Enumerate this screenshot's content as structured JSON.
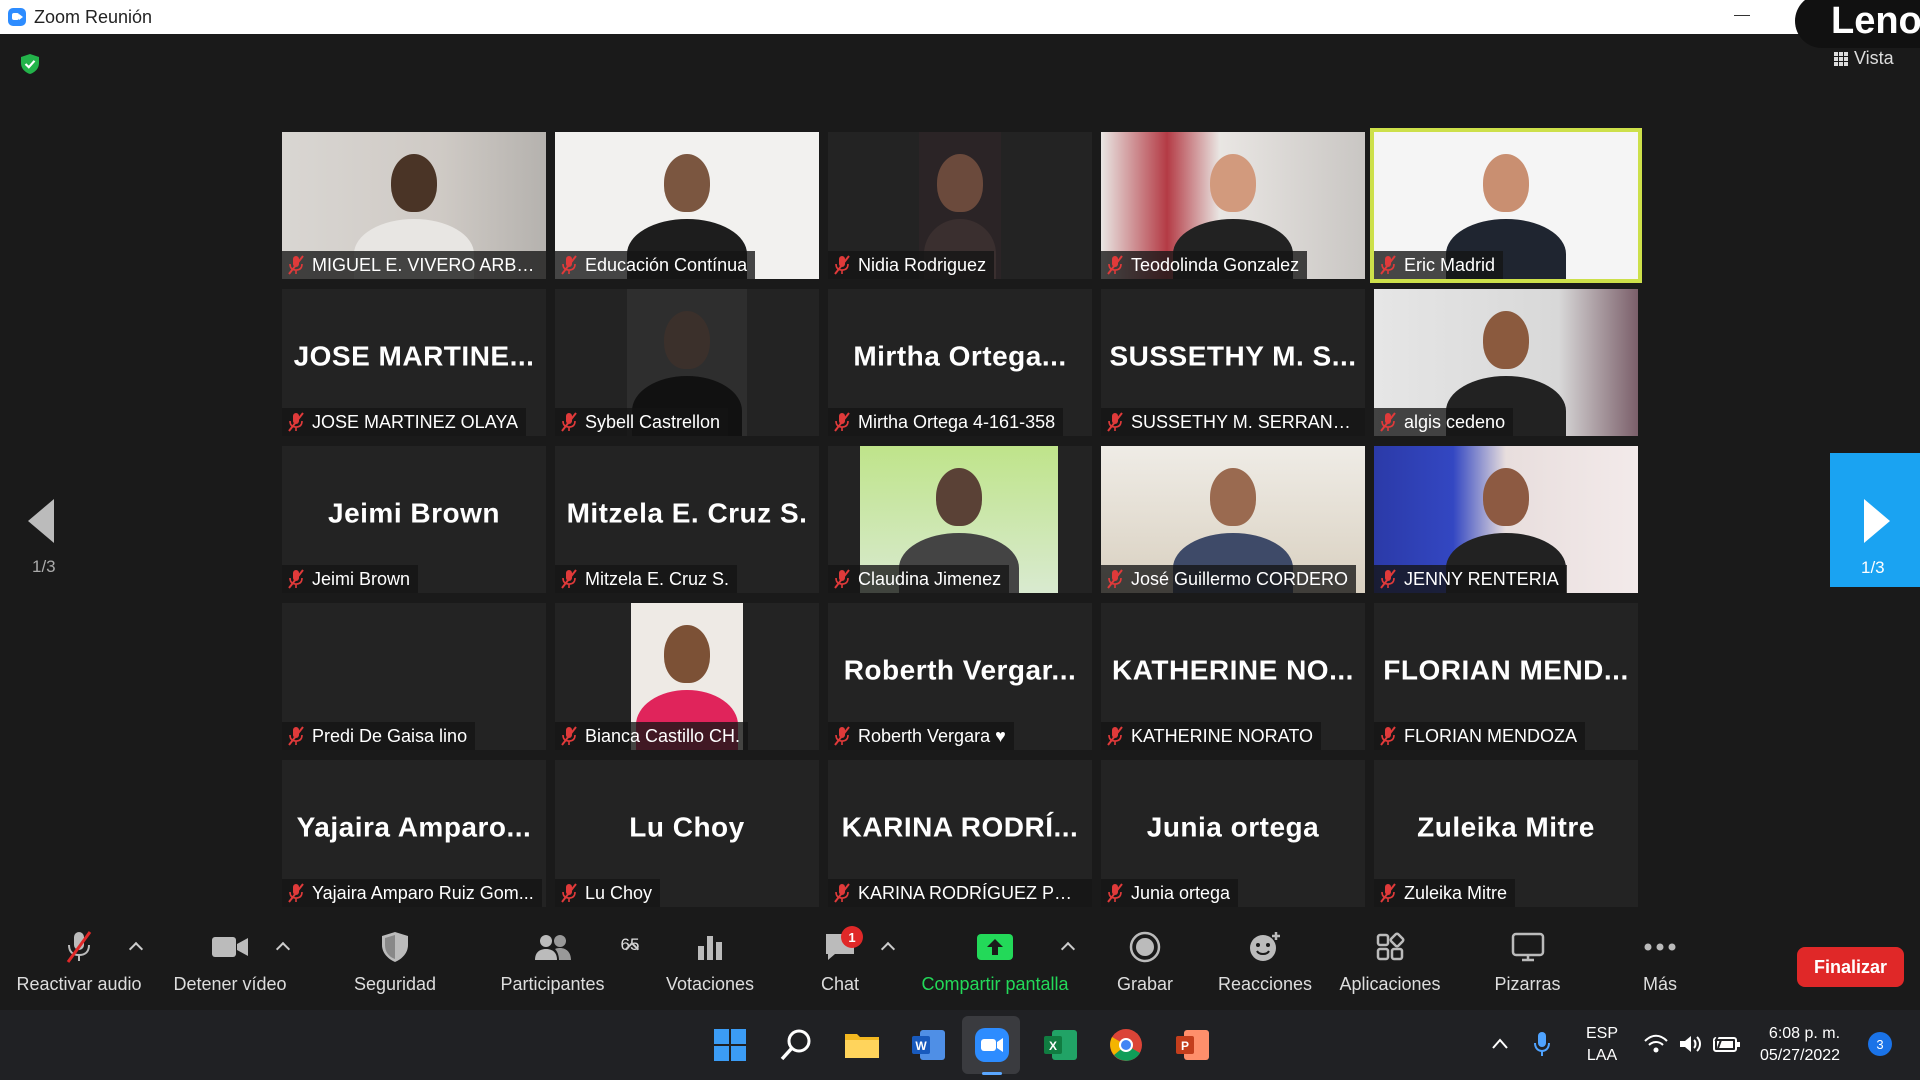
{
  "window": {
    "title": "Zoom Reunión",
    "brand": "Lenovo"
  },
  "header": {
    "view_label": "Vista"
  },
  "participants": [
    {
      "display": "",
      "label": "MIGUEL E. VIVERO ARBO...",
      "video": true
    },
    {
      "display": "",
      "label": "Educación Contínua",
      "video": true
    },
    {
      "display": "",
      "label": "Nidia Rodriguez",
      "video": true
    },
    {
      "display": "",
      "label": "Teodolinda Gonzalez",
      "video": true
    },
    {
      "display": "",
      "label": "Eric Madrid",
      "video": true,
      "active": true
    },
    {
      "display": "JOSE  MARTINE...",
      "label": "JOSE MARTINEZ OLAYA",
      "video": false
    },
    {
      "display": "",
      "label": "Sybell Castrellon",
      "video": true
    },
    {
      "display": "Mirtha  Ortega...",
      "label": "Mirtha Ortega 4-161-358",
      "video": false
    },
    {
      "display": "SUSSETHY  M.  S...",
      "label": "SUSSETHY M. SERRANO J.",
      "video": false
    },
    {
      "display": "",
      "label": "algis cedeno",
      "video": true
    },
    {
      "display": "Jeimi Brown",
      "label": "Jeimi Brown",
      "video": false
    },
    {
      "display": "Mitzela E. Cruz S.",
      "label": "Mitzela E. Cruz S.",
      "video": false
    },
    {
      "display": "",
      "label": "Claudina Jimenez",
      "video": true
    },
    {
      "display": "",
      "label": "José Guillermo CORDERO",
      "video": true
    },
    {
      "display": "",
      "label": "JENNY RENTERIA",
      "video": true
    },
    {
      "display": "",
      "label": "Predi De Gaisa lino",
      "video": false
    },
    {
      "display": "",
      "label": "Bianca Castillo CH.",
      "video": true
    },
    {
      "display": "Roberth  Vergar...",
      "label": "Roberth Vergara ♥",
      "video": false
    },
    {
      "display": "KATHERINE  NO...",
      "label": "KATHERINE NORATO",
      "video": false
    },
    {
      "display": "FLORIAN  MEND...",
      "label": "FLORIAN MENDOZA",
      "video": false
    },
    {
      "display": "Yajaira  Amparo...",
      "label": "Yajaira Amparo Ruiz Gom...",
      "video": false
    },
    {
      "display": "Lu Choy",
      "label": "Lu Choy",
      "video": false
    },
    {
      "display": "KARINA  RODRÍ...",
      "label": "KARINA RODRÍGUEZ PEÑ...",
      "video": false
    },
    {
      "display": "Junia ortega",
      "label": "Junia ortega",
      "video": false
    },
    {
      "display": "Zuleika Mitre",
      "label": "Zuleika Mitre",
      "video": false
    }
  ],
  "pagination": {
    "prev": "1/3",
    "next": "1/3"
  },
  "toolbar": {
    "unmute": "Reactivar audio",
    "stop_video": "Detener vídeo",
    "security": "Seguridad",
    "participants": "Participantes",
    "participant_count": "65",
    "polls": "Votaciones",
    "chat": "Chat",
    "chat_badge": "1",
    "share": "Compartir pantalla",
    "record": "Grabar",
    "reactions": "Reacciones",
    "apps": "Aplicaciones",
    "whiteboards": "Pizarras",
    "more": "Más",
    "end": "Finalizar"
  },
  "taskbar": {
    "lang1": "ESP",
    "lang2": "LAA",
    "time": "6:08 p. m.",
    "date": "05/27/2022",
    "notifications": "3"
  },
  "colors": {
    "accent": "#2d8cff",
    "share": "#23d959",
    "end": "#e02828",
    "active_speaker": "#cde04a",
    "next_page": "#1aa3f2"
  }
}
